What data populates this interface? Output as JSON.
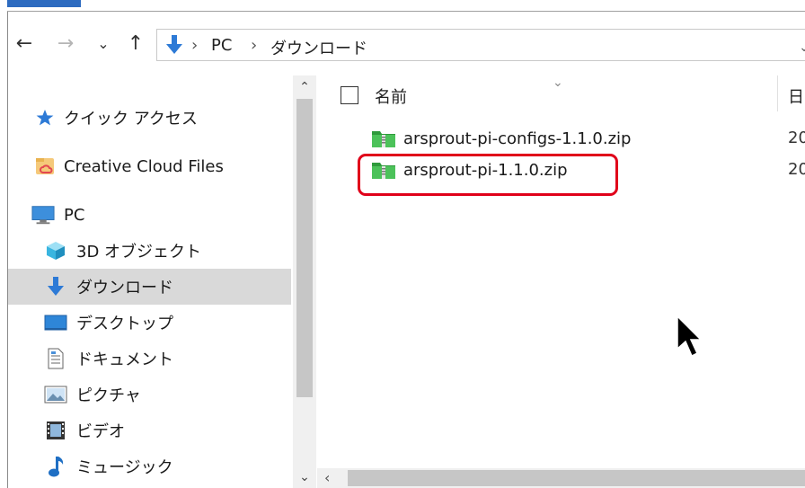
{
  "nav": {
    "back_glyph": "←",
    "forward_glyph": "→",
    "recent_glyph": "⌄",
    "up_glyph": "↑",
    "address_crumbs": [
      "PC",
      "ダウンロード"
    ],
    "crumb_separator": "›",
    "address_dropdown_glyph": "⌄"
  },
  "sidebar": {
    "items": [
      {
        "label": "クイック アクセス",
        "icon": "star-icon"
      },
      {
        "label": "Creative Cloud Files",
        "icon": "creative-cloud-icon"
      },
      {
        "label": "PC",
        "icon": "computer-icon"
      },
      {
        "label": "3D オブジェクト",
        "icon": "cube-icon"
      },
      {
        "label": "ダウンロード",
        "icon": "download-icon",
        "selected": true
      },
      {
        "label": "デスクトップ",
        "icon": "desktop-icon"
      },
      {
        "label": "ドキュメント",
        "icon": "document-icon"
      },
      {
        "label": "ピクチャ",
        "icon": "picture-icon"
      },
      {
        "label": "ビデオ",
        "icon": "video-icon"
      },
      {
        "label": "ミュージック",
        "icon": "music-icon"
      }
    ],
    "scroll_up_glyph": "⌃",
    "scroll_down_glyph": "⌄"
  },
  "filelist": {
    "column_name": "名前",
    "column_date_partial": "日",
    "sort_glyph": "⌄",
    "files": [
      {
        "name": "arsprout-pi-configs-1.1.0.zip",
        "date_partial": "20",
        "icon": "zip-folder-icon"
      },
      {
        "name": "arsprout-pi-1.1.0.zip",
        "date_partial": "20",
        "icon": "zip-folder-icon",
        "highlighted": true
      }
    ],
    "hscroll_left_glyph": "‹"
  },
  "colors": {
    "accent": "#2d6bc0",
    "selection": "#d9d9d9",
    "highlight_box": "#e0001a",
    "zip_green": "#3aa745"
  }
}
